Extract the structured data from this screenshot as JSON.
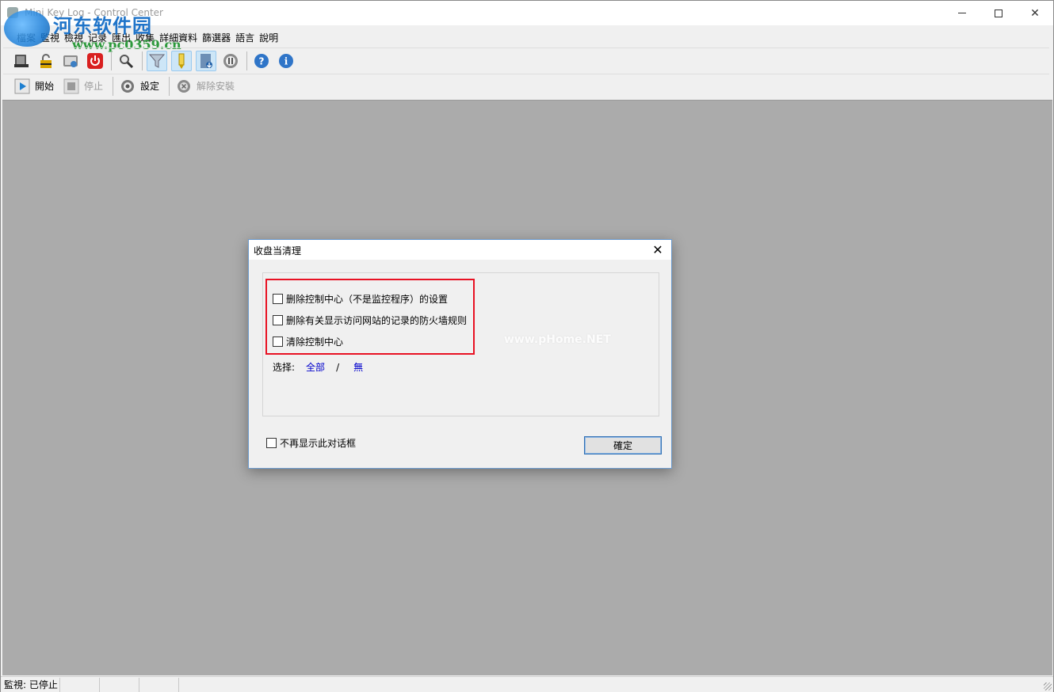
{
  "window": {
    "title": "Mini Key Log - Control Center",
    "controls": {
      "minimize": "—",
      "maximize": "□",
      "close": "✕"
    }
  },
  "watermark": {
    "name": "河东软件园",
    "url": "www.pc0359.cn"
  },
  "menu": [
    "檔案",
    "監視",
    "檢視",
    "记录",
    "匯出",
    "收集",
    "詳細資料",
    "篩選器",
    "語言",
    "說明"
  ],
  "toolbar_icons": [
    "log-viewer-icon",
    "lock-icon",
    "screenshot-icon",
    "power-icon",
    "search-icon",
    "filter-icon",
    "highlighter-icon",
    "export-icon",
    "pause-icon",
    "help-icon",
    "info-icon"
  ],
  "toolbar2": {
    "start_label": "開始",
    "stop_label": "停止",
    "settings_label": "設定",
    "uninstall_label": "解除安裝"
  },
  "status": {
    "monitor": "監視: 已停止"
  },
  "dialog": {
    "title": "收盘当清理",
    "options": [
      "删除控制中心（不是监控程序）的设置",
      "删除有关显示访问网站的记录的防火墙规则",
      "清除控制中心"
    ],
    "select_label": "选择:",
    "select_all": "全部",
    "select_slash": "/",
    "select_none": "無",
    "dont_show": "不再显示此对话框",
    "ok": "確定",
    "faint_watermark": "www.pHome.NET"
  },
  "colors": {
    "accent_red": "#e81123",
    "link_blue": "#0000cc",
    "client_gray": "#ababab"
  }
}
